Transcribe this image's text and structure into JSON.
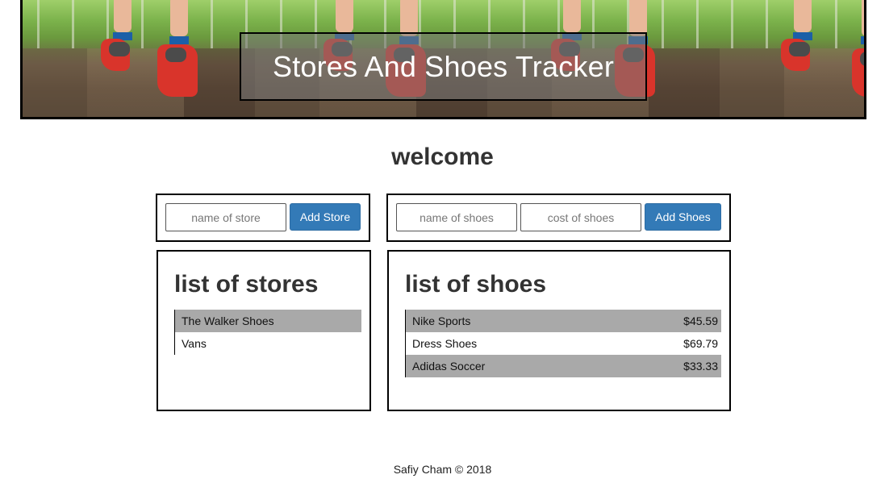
{
  "header": {
    "title": "Stores And Shoes Tracker"
  },
  "welcome": "welcome",
  "store_form": {
    "name_placeholder": "name of store",
    "add_label": "Add Store"
  },
  "shoes_form": {
    "name_placeholder": "name of shoes",
    "cost_placeholder": "cost of shoes",
    "add_label": "Add Shoes"
  },
  "stores": {
    "heading": "list of stores",
    "items": [
      {
        "name": "The Walker Shoes"
      },
      {
        "name": "Vans"
      }
    ]
  },
  "shoes": {
    "heading": "list of shoes",
    "items": [
      {
        "name": "Nike Sports",
        "cost": "$45.59"
      },
      {
        "name": "Dress Shoes",
        "cost": "$69.79"
      },
      {
        "name": "Adidas Soccer",
        "cost": "$33.33"
      }
    ]
  },
  "footer": "Safiy Cham © 2018",
  "colors": {
    "button": "#337ab7",
    "row_alt": "#a9a9a9"
  }
}
